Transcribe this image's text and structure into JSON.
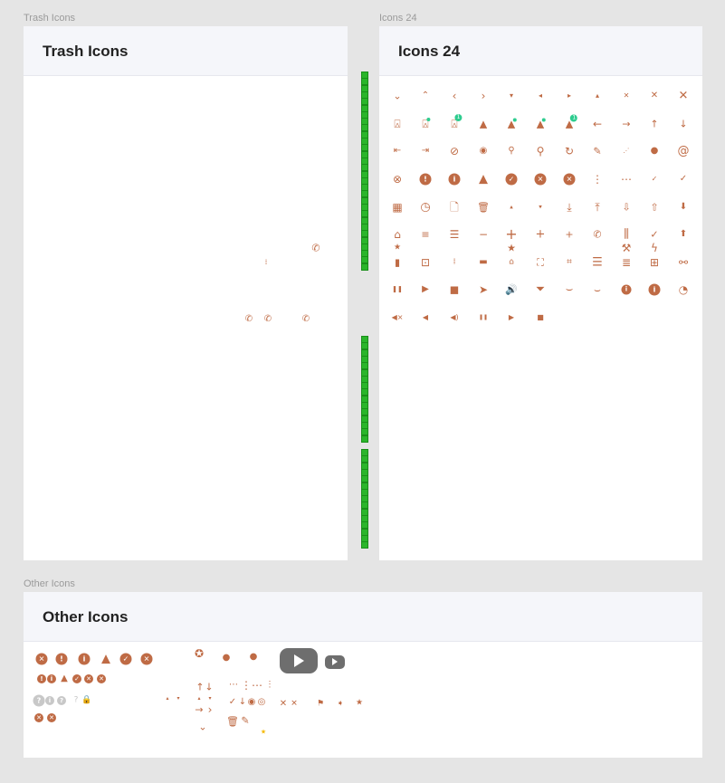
{
  "canvas": {
    "icon_color": "#bf6b45",
    "badge_color": "#2ecc8f",
    "youtube_color": "#6e6e6e"
  },
  "frames": {
    "trash": {
      "label": "Trash Icons",
      "title": "Trash Icons",
      "icons": [
        "phone-callback-icon",
        "grid-dots-icon",
        "phone-forward-icon",
        "phone-missed-icon",
        "phone-alert-icon"
      ]
    },
    "icons24": {
      "label": "Icons 24",
      "title": "Icons 24",
      "icons": [
        "chevron-down-icon",
        "chevron-up-icon",
        "chevron-left-icon",
        "chevron-right-icon",
        "caret-down-icon",
        "caret-left-icon",
        "caret-right-icon",
        "caret-up-icon",
        "close-small-icon",
        "close-icon",
        "close-large-icon",
        "bell-icon",
        "bell-dot-icon",
        "bell-badge-icon",
        "bell-filled-icon",
        "bell-filled-dot-icon",
        "bell-filled-dot-2-icon",
        "bell-filled-badge-icon",
        "arrow-left-icon",
        "arrow-right-icon",
        "arrow-up-icon",
        "arrow-down-icon",
        "first-page-icon",
        "last-page-icon",
        "eye-off-icon",
        "eye-icon",
        "search-small-icon",
        "search-icon",
        "refresh-icon",
        "pencil-icon",
        "signal-icon",
        "person-icon",
        "at-icon",
        "close-circle-outline-icon",
        "exclamation-circle-icon",
        "info-circle-icon",
        "warning-icon",
        "check-circle-icon",
        "close-circle-icon",
        "close-circle-2-icon",
        "more-vertical-icon",
        "more-horizontal-icon",
        "check-small-icon",
        "check-icon",
        "calendar-icon",
        "clock-icon",
        "file-icon",
        "trash-icon",
        "caret-up-small-icon",
        "caret-down-small-icon",
        "download-icon",
        "upload-icon",
        "download-arrow-icon",
        "upload-arrow-icon",
        "download-filled-icon",
        "home-icon",
        "filter-lines-icon",
        "menu-icon",
        "minus-icon",
        "plus-large-icon",
        "plus-icon",
        "plus-small-icon",
        "phone-callback-icon",
        "sliders-icon",
        "check-thin-icon",
        "upload-filled-icon",
        "star-icon",
        "star-large-icon",
        "tools-icon",
        "lightning-icon",
        "trash-filled-icon",
        "archive-icon",
        "drag-handle-icon",
        "divider-icon",
        "home-small-icon",
        "fullscreen-icon",
        "exit-fullscreen-icon",
        "rows-icon",
        "list-icon",
        "grid-icon",
        "paperclip-icon",
        "pause-icon",
        "play-icon",
        "stop-icon",
        "send-icon",
        "volume-icon",
        "funnel-icon",
        "eye-closed-icon",
        "eye-closed-2-icon",
        "info-filled-icon",
        "info-filled-large-icon",
        "speedometer-icon",
        "volume-mute-icon",
        "volume-low-icon",
        "volume-medium-icon",
        "pause-small-icon",
        "play-small-icon",
        "stop-small-icon"
      ],
      "badge_text": "1"
    },
    "other": {
      "label": "Other Icons",
      "title": "Other Icons",
      "icons": [
        "close-circle-icon",
        "exclamation-circle-icon",
        "info-circle-icon",
        "warning-icon",
        "check-circle-icon",
        "close-circle-icon",
        "exclamation-circle-small-icon",
        "info-circle-small-icon",
        "warning-small-icon",
        "check-circle-small-icon",
        "close-circle-small-icon",
        "close-circle-small-2-icon",
        "question-circle-gray-icon",
        "info-circle-gray-icon",
        "question-circle-gray-small-icon",
        "question-outline-gray-icon",
        "lock-gray-icon",
        "close-circle-tiny-icon",
        "close-circle-tiny-2-icon",
        "award-icon",
        "person-icon",
        "person-round-icon",
        "youtube-large-icon",
        "youtube-small-icon",
        "arrow-up-icon",
        "arrow-down-icon",
        "caret-up-tiny-icon",
        "caret-down-tiny-icon",
        "caret-up-tiny-2-icon",
        "caret-down-tiny-2-icon",
        "arrow-right-icon",
        "chevron-right-icon",
        "chevron-down-icon",
        "more-horizontal-light-icon",
        "more-vertical-icon",
        "more-horizontal-icon",
        "more-vertical-small-icon",
        "check-icon",
        "arrow-down-small-icon",
        "eye-icon",
        "eye-outline-icon",
        "trash-icon",
        "pencil-icon",
        "star-yellow-icon",
        "close-icon",
        "close-2-icon",
        "flag-icon",
        "label-icon",
        "star-icon"
      ]
    }
  }
}
